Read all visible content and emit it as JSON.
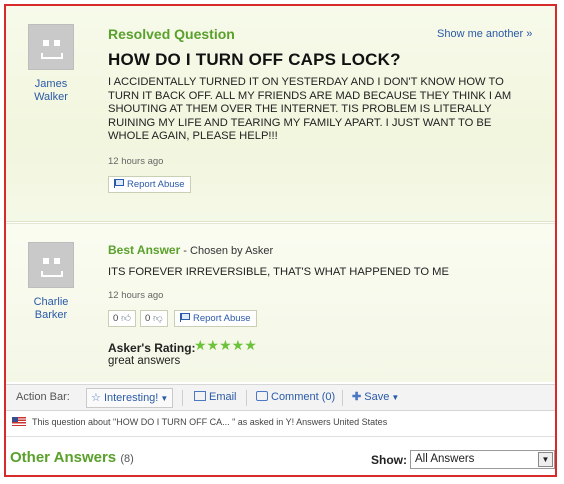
{
  "question": {
    "header": "Resolved Question",
    "show_another": "Show me another »",
    "asker_name_line1": "James",
    "asker_name_line2": "Walker",
    "title": "HOW DO I TURN OFF CAPS LOCK?",
    "body": "I ACCIDENTALLY TURNED IT ON YESTERDAY AND I DON'T KNOW HOW TO TURN IT BACK OFF. ALL MY FRIENDS ARE MAD BECAUSE THEY THINK I AM SHOUTING AT THEM OVER THE INTERNET. TIS PROBLEM IS LITERALLY RUINING MY LIFE AND TEARING MY FAMILY APART. I JUST WANT TO BE WHOLE AGAIN, PLEASE HELP!!!",
    "time": "12 hours ago",
    "report_label": "Report Abuse"
  },
  "best_answer": {
    "header": "Best Answer",
    "chosen_by": " - Chosen by Asker",
    "answerer_name_line1": "Charlie",
    "answerer_name_line2": "Barker",
    "body": "ITS FOREVER IRREVERSIBLE, THAT'S WHAT HAPPENED TO ME",
    "time": "12 hours ago",
    "thumbs_up_count": "0",
    "thumbs_down_count": "0",
    "report_label": "Report Abuse",
    "rating_label": "Asker's Rating:",
    "rating_stars": "★★★★★",
    "rating_value": 5,
    "rating_comment": "great answers"
  },
  "action_bar": {
    "label": "Action Bar:",
    "interesting": "Interesting!",
    "email": "Email",
    "comment": "Comment (0)",
    "save": "Save"
  },
  "notice": "This question about \"HOW DO I TURN OFF CA... \" as asked in Y! Answers United States",
  "other_answers": {
    "title": "Other Answers",
    "count": "(8)",
    "show_label": "Show:",
    "show_value": "All Answers"
  },
  "colors": {
    "accent_green": "#5aa02c",
    "link_blue": "#2b5aa8",
    "frame_red": "#d72b2b",
    "star_green": "#6cc23a"
  }
}
